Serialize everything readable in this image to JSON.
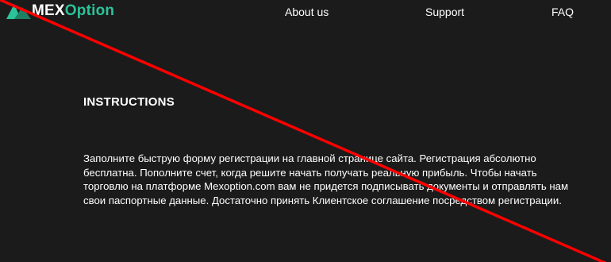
{
  "header": {
    "logo": {
      "brand_part1": "MEX",
      "brand_part2": "Option",
      "icon": "triangle-logo-icon",
      "colors": {
        "brand_accent": "#2cc39a",
        "brand_dark": "#1f7f63"
      }
    },
    "nav": [
      {
        "label": "About us"
      },
      {
        "label": "Support"
      },
      {
        "label": "FAQ"
      }
    ]
  },
  "main": {
    "heading": "INSTRUCTIONS",
    "paragraph": "Заполните быструю форму регистрации на главной странице сайта. Регистрация абсолютно бесплатна. Пополните счет, когда решите начать получать реальную прибыль. Чтобы начать торговлю на платформе Mexoption.com вам не придется подписывать документы и отправлять нам свои паспортные данные. Достаточно принять Клиентское соглашение посредством регистрации."
  },
  "overlay": {
    "type": "red-diagonal-strike-line",
    "color": "#ff0000"
  },
  "colors": {
    "background": "#1b1b1b",
    "text": "#ffffff"
  }
}
